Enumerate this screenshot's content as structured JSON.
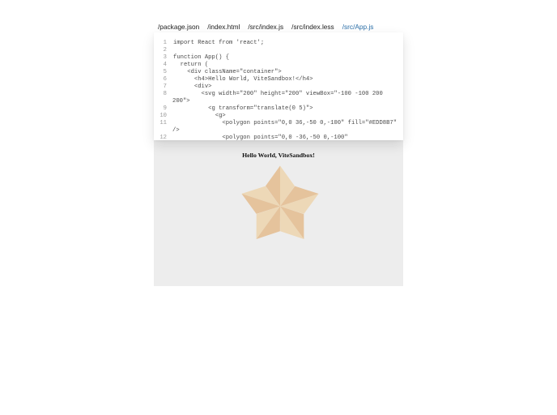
{
  "tabs": [
    {
      "label": "/package.json",
      "active": false
    },
    {
      "label": "/index.html",
      "active": false
    },
    {
      "label": "/src/index.js",
      "active": false
    },
    {
      "label": "/src/index.less",
      "active": false
    },
    {
      "label": "/src/App.js",
      "active": true
    }
  ],
  "code": {
    "lines": [
      {
        "n": "1",
        "text": "import React from 'react';"
      },
      {
        "n": "2",
        "text": ""
      },
      {
        "n": "3",
        "text": "function App() {"
      },
      {
        "n": "4",
        "text": "  return ("
      },
      {
        "n": "5",
        "text": "    <div className=\"container\">"
      },
      {
        "n": "6",
        "text": "      <h4>Hello World, ViteSandbox!</h4>"
      },
      {
        "n": "7",
        "text": "      <div>"
      },
      {
        "n": "8",
        "text": "        <svg width=\"200\" height=\"200\" viewBox=\"-100 -100 200"
      },
      {
        "n": "",
        "text": "200\">"
      },
      {
        "n": "9",
        "text": "          <g transform=\"translate(0 5)\">"
      },
      {
        "n": "10",
        "text": "            <g>"
      },
      {
        "n": "11",
        "text": "              <polygon points=\"0,0 36,-50 0,-100\" fill=\"#EDD8B7\""
      },
      {
        "n": "",
        "text": "/>"
      },
      {
        "n": "12",
        "text": "              <polygon points=\"0,0 -36,-50 0,-100\""
      }
    ]
  },
  "preview": {
    "heading": "Hello World, ViteSandbox!",
    "star_colors": {
      "light": "#EDD8B7",
      "mid": "#E5C39C",
      "dark": "#DDB58A"
    }
  }
}
